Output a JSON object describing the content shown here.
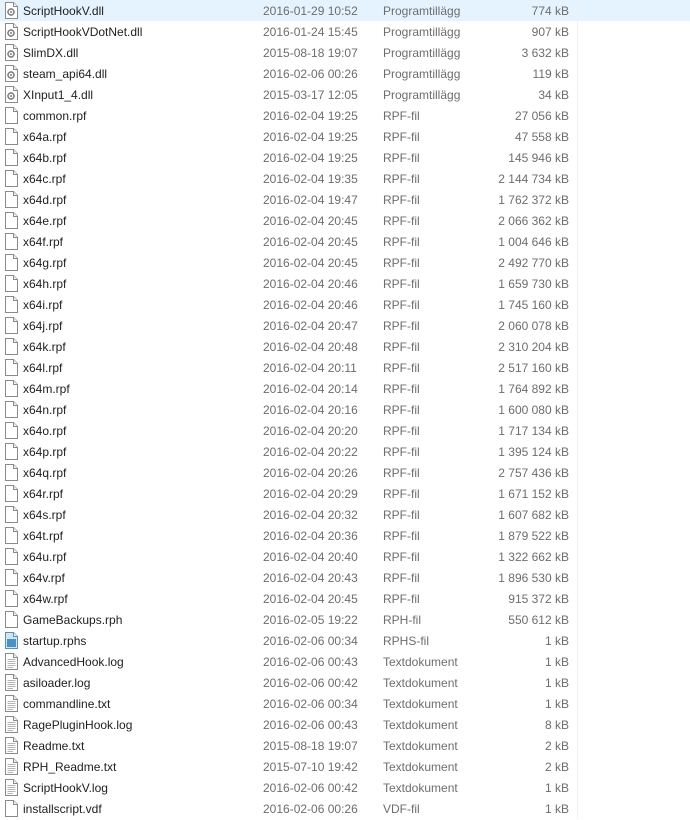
{
  "files": [
    {
      "name": "ScriptHookV.dll",
      "date": "2016-01-29 10:52",
      "type": "Programtillägg",
      "size": "774 kB",
      "icon": "dll-file-icon"
    },
    {
      "name": "ScriptHookVDotNet.dll",
      "date": "2016-01-24 15:45",
      "type": "Programtillägg",
      "size": "907 kB",
      "icon": "dll-file-icon"
    },
    {
      "name": "SlimDX.dll",
      "date": "2015-08-18 19:07",
      "type": "Programtillägg",
      "size": "3 632 kB",
      "icon": "dll-file-icon"
    },
    {
      "name": "steam_api64.dll",
      "date": "2016-02-06 00:26",
      "type": "Programtillägg",
      "size": "119 kB",
      "icon": "dll-file-icon"
    },
    {
      "name": "XInput1_4.dll",
      "date": "2015-03-17 12:05",
      "type": "Programtillägg",
      "size": "34 kB",
      "icon": "dll-file-icon"
    },
    {
      "name": "common.rpf",
      "date": "2016-02-04 19:25",
      "type": "RPF-fil",
      "size": "27 056 kB",
      "icon": "file-icon"
    },
    {
      "name": "x64a.rpf",
      "date": "2016-02-04 19:25",
      "type": "RPF-fil",
      "size": "47 558 kB",
      "icon": "file-icon"
    },
    {
      "name": "x64b.rpf",
      "date": "2016-02-04 19:25",
      "type": "RPF-fil",
      "size": "145 946 kB",
      "icon": "file-icon"
    },
    {
      "name": "x64c.rpf",
      "date": "2016-02-04 19:35",
      "type": "RPF-fil",
      "size": "2 144 734 kB",
      "icon": "file-icon"
    },
    {
      "name": "x64d.rpf",
      "date": "2016-02-04 19:47",
      "type": "RPF-fil",
      "size": "1 762 372 kB",
      "icon": "file-icon"
    },
    {
      "name": "x64e.rpf",
      "date": "2016-02-04 20:45",
      "type": "RPF-fil",
      "size": "2 066 362 kB",
      "icon": "file-icon"
    },
    {
      "name": "x64f.rpf",
      "date": "2016-02-04 20:45",
      "type": "RPF-fil",
      "size": "1 004 646 kB",
      "icon": "file-icon"
    },
    {
      "name": "x64g.rpf",
      "date": "2016-02-04 20:45",
      "type": "RPF-fil",
      "size": "2 492 770 kB",
      "icon": "file-icon"
    },
    {
      "name": "x64h.rpf",
      "date": "2016-02-04 20:46",
      "type": "RPF-fil",
      "size": "1 659 730 kB",
      "icon": "file-icon"
    },
    {
      "name": "x64i.rpf",
      "date": "2016-02-04 20:46",
      "type": "RPF-fil",
      "size": "1 745 160 kB",
      "icon": "file-icon"
    },
    {
      "name": "x64j.rpf",
      "date": "2016-02-04 20:47",
      "type": "RPF-fil",
      "size": "2 060 078 kB",
      "icon": "file-icon"
    },
    {
      "name": "x64k.rpf",
      "date": "2016-02-04 20:48",
      "type": "RPF-fil",
      "size": "2 310 204 kB",
      "icon": "file-icon"
    },
    {
      "name": "x64l.rpf",
      "date": "2016-02-04 20:11",
      "type": "RPF-fil",
      "size": "2 517 160 kB",
      "icon": "file-icon"
    },
    {
      "name": "x64m.rpf",
      "date": "2016-02-04 20:14",
      "type": "RPF-fil",
      "size": "1 764 892 kB",
      "icon": "file-icon"
    },
    {
      "name": "x64n.rpf",
      "date": "2016-02-04 20:16",
      "type": "RPF-fil",
      "size": "1 600 080 kB",
      "icon": "file-icon"
    },
    {
      "name": "x64o.rpf",
      "date": "2016-02-04 20:20",
      "type": "RPF-fil",
      "size": "1 717 134 kB",
      "icon": "file-icon"
    },
    {
      "name": "x64p.rpf",
      "date": "2016-02-04 20:22",
      "type": "RPF-fil",
      "size": "1 395 124 kB",
      "icon": "file-icon"
    },
    {
      "name": "x64q.rpf",
      "date": "2016-02-04 20:26",
      "type": "RPF-fil",
      "size": "2 757 436 kB",
      "icon": "file-icon"
    },
    {
      "name": "x64r.rpf",
      "date": "2016-02-04 20:29",
      "type": "RPF-fil",
      "size": "1 671 152 kB",
      "icon": "file-icon"
    },
    {
      "name": "x64s.rpf",
      "date": "2016-02-04 20:32",
      "type": "RPF-fil",
      "size": "1 607 682 kB",
      "icon": "file-icon"
    },
    {
      "name": "x64t.rpf",
      "date": "2016-02-04 20:36",
      "type": "RPF-fil",
      "size": "1 879 522 kB",
      "icon": "file-icon"
    },
    {
      "name": "x64u.rpf",
      "date": "2016-02-04 20:40",
      "type": "RPF-fil",
      "size": "1 322 662 kB",
      "icon": "file-icon"
    },
    {
      "name": "x64v.rpf",
      "date": "2016-02-04 20:43",
      "type": "RPF-fil",
      "size": "1 896 530 kB",
      "icon": "file-icon"
    },
    {
      "name": "x64w.rpf",
      "date": "2016-02-04 20:45",
      "type": "RPF-fil",
      "size": "915 372 kB",
      "icon": "file-icon"
    },
    {
      "name": "GameBackups.rph",
      "date": "2016-02-05 19:22",
      "type": "RPH-fil",
      "size": "550 612 kB",
      "icon": "file-icon"
    },
    {
      "name": "startup.rphs",
      "date": "2016-02-06 00:34",
      "type": "RPHS-fil",
      "size": "1 kB",
      "icon": "rphs-file-icon"
    },
    {
      "name": "AdvancedHook.log",
      "date": "2016-02-06 00:43",
      "type": "Textdokument",
      "size": "1 kB",
      "icon": "text-document-icon"
    },
    {
      "name": "asiloader.log",
      "date": "2016-02-06 00:42",
      "type": "Textdokument",
      "size": "1 kB",
      "icon": "text-document-icon"
    },
    {
      "name": "commandline.txt",
      "date": "2016-02-06 00:34",
      "type": "Textdokument",
      "size": "1 kB",
      "icon": "text-document-icon"
    },
    {
      "name": "RagePluginHook.log",
      "date": "2016-02-06 00:43",
      "type": "Textdokument",
      "size": "8 kB",
      "icon": "text-document-icon"
    },
    {
      "name": "Readme.txt",
      "date": "2015-08-18 19:07",
      "type": "Textdokument",
      "size": "2 kB",
      "icon": "text-document-icon"
    },
    {
      "name": "RPH_Readme.txt",
      "date": "2015-07-10 19:42",
      "type": "Textdokument",
      "size": "2 kB",
      "icon": "text-document-icon"
    },
    {
      "name": "ScriptHookV.log",
      "date": "2016-02-06 00:42",
      "type": "Textdokument",
      "size": "1 kB",
      "icon": "text-document-icon"
    },
    {
      "name": "installscript.vdf",
      "date": "2016-02-06 00:26",
      "type": "VDF-fil",
      "size": "1 kB",
      "icon": "file-icon"
    }
  ]
}
